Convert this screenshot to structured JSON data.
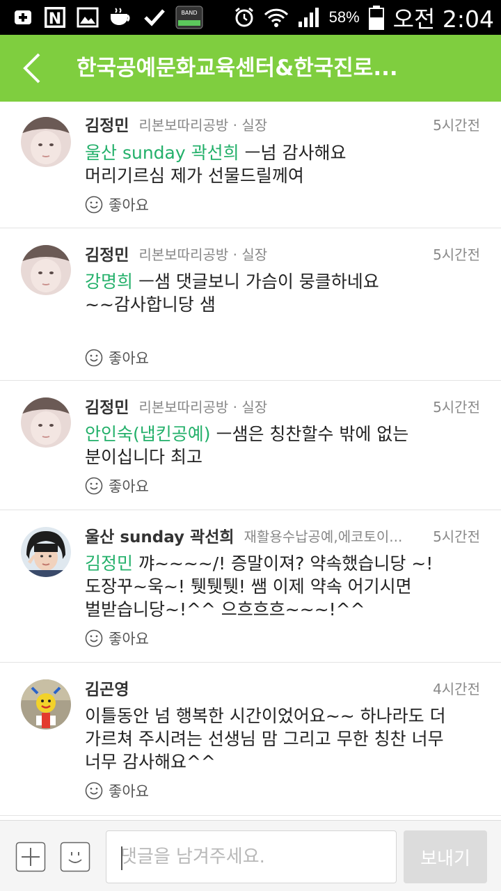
{
  "status_bar": {
    "icons_left": [
      "add-box-icon",
      "naver-n-icon",
      "image-icon",
      "coffee-icon",
      "check-icon",
      "band-icon"
    ],
    "icons_right": [
      "alarm-icon",
      "wifi-icon",
      "signal-icon",
      "battery-icon"
    ],
    "battery": "58%",
    "time": "오전 2:04"
  },
  "header": {
    "title": "한국공예문화교육센터&한국진로...",
    "bg_color": "#7fce3f"
  },
  "comments": [
    {
      "author": "김정민",
      "affiliation": "리본보따리공방 · 실장",
      "time": "5시간전",
      "mention": "울산 sunday 곽선희",
      "text_first": " ㅡ넘 감사해요",
      "text_rest": [
        "머리기르심 제가  선물드릴께여"
      ],
      "like_label": "좋아요"
    },
    {
      "author": "김정민",
      "affiliation": "리본보따리공방 · 실장",
      "time": "5시간전",
      "mention": "강명희",
      "text_first": " ㅡ샘 댓글보니  가슴이 뭉클하네요",
      "text_rest": [
        "~~감사합니당 샘"
      ],
      "like_label": "좋아요"
    },
    {
      "author": "김정민",
      "affiliation": "리본보따리공방 · 실장",
      "time": "5시간전",
      "mention": "안인숙(냅킨공예)",
      "text_first": " ㅡ샘은 칭찬할수 밖에 없는",
      "text_rest": [
        "분이십니다  최고"
      ],
      "like_label": "좋아요"
    },
    {
      "author": "울산 sunday 곽선희",
      "affiliation": "재활용수납공예,에코토이...",
      "time": "5시간전",
      "mention": "김정민",
      "text_first": " 꺄~~~~/! 증말이져? 약속했습니당 ~!",
      "text_rest": [
        "도장꾸~욱~! 퉷퉷퉷! 쌤 이제 약속 어기시면",
        "벌받습니당~!^^ 으흐흐흐~~~!^^"
      ],
      "like_label": "좋아요"
    },
    {
      "author": "김곤영",
      "affiliation": "",
      "time": "4시간전",
      "mention": "",
      "text_first": "이틀동안 넘 행복한 시간이었어요~~ 하나라도 더",
      "text_rest": [
        "가르쳐 주시려는 선생님 맘 그리고 무한 칭찬 너무",
        "너무  감사해요^^"
      ],
      "like_label": "좋아요"
    }
  ],
  "bottom_bar": {
    "input_placeholder": "댓글을 남겨주세요.",
    "send_label": "보내기"
  }
}
